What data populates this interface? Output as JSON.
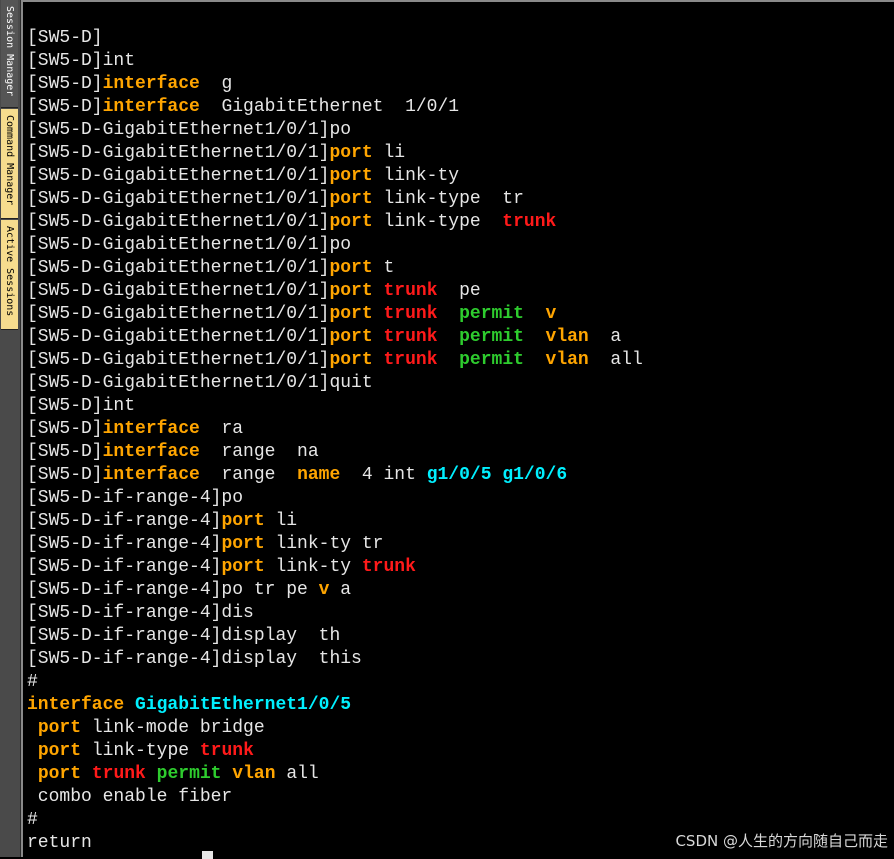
{
  "sidebar": {
    "tabs": [
      "Session Manager",
      "Command Manager",
      "Active Sessions"
    ]
  },
  "terminal": {
    "lines": [
      [
        [
          "[SW5-D]",
          "w"
        ]
      ],
      [
        [
          "[SW5-D]int",
          "w"
        ]
      ],
      [
        [
          "[SW5-D]",
          "w"
        ],
        [
          "interface",
          "o"
        ],
        [
          "  g",
          "w"
        ]
      ],
      [
        [
          "[SW5-D]",
          "w"
        ],
        [
          "interface",
          "o"
        ],
        [
          "  GigabitEthernet  1/0/1",
          "w"
        ]
      ],
      [
        [
          "[SW5-D-GigabitEthernet1/0/1]po",
          "w"
        ]
      ],
      [
        [
          "[SW5-D-GigabitEthernet1/0/1]",
          "w"
        ],
        [
          "port",
          "o"
        ],
        [
          " li",
          "w"
        ]
      ],
      [
        [
          "[SW5-D-GigabitEthernet1/0/1]",
          "w"
        ],
        [
          "port",
          "o"
        ],
        [
          " link-ty",
          "w"
        ]
      ],
      [
        [
          "[SW5-D-GigabitEthernet1/0/1]",
          "w"
        ],
        [
          "port",
          "o"
        ],
        [
          " link-type  tr",
          "w"
        ]
      ],
      [
        [
          "[SW5-D-GigabitEthernet1/0/1]",
          "w"
        ],
        [
          "port",
          "o"
        ],
        [
          " link-type  ",
          "w"
        ],
        [
          "trunk",
          "r"
        ]
      ],
      [
        [
          "[SW5-D-GigabitEthernet1/0/1]po",
          "w"
        ]
      ],
      [
        [
          "[SW5-D-GigabitEthernet1/0/1]",
          "w"
        ],
        [
          "port",
          "o"
        ],
        [
          " t",
          "w"
        ]
      ],
      [
        [
          "[SW5-D-GigabitEthernet1/0/1]",
          "w"
        ],
        [
          "port",
          "o"
        ],
        [
          " ",
          "w"
        ],
        [
          "trunk",
          "r"
        ],
        [
          "  pe",
          "w"
        ]
      ],
      [
        [
          "[SW5-D-GigabitEthernet1/0/1]",
          "w"
        ],
        [
          "port",
          "o"
        ],
        [
          " ",
          "w"
        ],
        [
          "trunk",
          "r"
        ],
        [
          "  ",
          "w"
        ],
        [
          "permit",
          "g"
        ],
        [
          "  ",
          "w"
        ],
        [
          "v",
          "o"
        ]
      ],
      [
        [
          "[SW5-D-GigabitEthernet1/0/1]",
          "w"
        ],
        [
          "port",
          "o"
        ],
        [
          " ",
          "w"
        ],
        [
          "trunk",
          "r"
        ],
        [
          "  ",
          "w"
        ],
        [
          "permit",
          "g"
        ],
        [
          "  ",
          "w"
        ],
        [
          "vlan",
          "o"
        ],
        [
          "  a",
          "w"
        ]
      ],
      [
        [
          "[SW5-D-GigabitEthernet1/0/1]",
          "w"
        ],
        [
          "port",
          "o"
        ],
        [
          " ",
          "w"
        ],
        [
          "trunk",
          "r"
        ],
        [
          "  ",
          "w"
        ],
        [
          "permit",
          "g"
        ],
        [
          "  ",
          "w"
        ],
        [
          "vlan",
          "o"
        ],
        [
          "  all",
          "w"
        ]
      ],
      [
        [
          "[SW5-D-GigabitEthernet1/0/1]quit",
          "w"
        ]
      ],
      [
        [
          "[SW5-D]int",
          "w"
        ]
      ],
      [
        [
          "[SW5-D]",
          "w"
        ],
        [
          "interface",
          "o"
        ],
        [
          "  ra",
          "w"
        ]
      ],
      [
        [
          "[SW5-D]",
          "w"
        ],
        [
          "interface",
          "o"
        ],
        [
          "  range  na",
          "w"
        ]
      ],
      [
        [
          "[SW5-D]",
          "w"
        ],
        [
          "interface",
          "o"
        ],
        [
          "  range  ",
          "w"
        ],
        [
          "name",
          "o"
        ],
        [
          "  4 int ",
          "w"
        ],
        [
          "g1/0/5 g1/0/6",
          "c"
        ]
      ],
      [
        [
          "[SW5-D-if-range-4]po",
          "w"
        ]
      ],
      [
        [
          "[SW5-D-if-range-4]",
          "w"
        ],
        [
          "port",
          "o"
        ],
        [
          " li",
          "w"
        ]
      ],
      [
        [
          "[SW5-D-if-range-4]",
          "w"
        ],
        [
          "port",
          "o"
        ],
        [
          " link-ty tr",
          "w"
        ]
      ],
      [
        [
          "[SW5-D-if-range-4]",
          "w"
        ],
        [
          "port",
          "o"
        ],
        [
          " link-ty ",
          "w"
        ],
        [
          "trunk",
          "r"
        ]
      ],
      [
        [
          "[SW5-D-if-range-4]po tr pe ",
          "w"
        ],
        [
          "v",
          "o"
        ],
        [
          " a",
          "w"
        ]
      ],
      [
        [
          "[SW5-D-if-range-4]dis",
          "w"
        ]
      ],
      [
        [
          "[SW5-D-if-range-4]display  th",
          "w"
        ]
      ],
      [
        [
          "[SW5-D-if-range-4]display  this",
          "w"
        ]
      ],
      [
        [
          "#",
          "w"
        ]
      ],
      [
        [
          "interface",
          "o"
        ],
        [
          " ",
          "w"
        ],
        [
          "GigabitEthernet1/0/5",
          "c"
        ]
      ],
      [
        [
          " ",
          "w"
        ],
        [
          "port",
          "o"
        ],
        [
          " link-mode bridge",
          "w"
        ]
      ],
      [
        [
          " ",
          "w"
        ],
        [
          "port",
          "o"
        ],
        [
          " link-type ",
          "w"
        ],
        [
          "trunk",
          "r"
        ]
      ],
      [
        [
          " ",
          "w"
        ],
        [
          "port",
          "o"
        ],
        [
          " ",
          "w"
        ],
        [
          "trunk",
          "r"
        ],
        [
          " ",
          "w"
        ],
        [
          "permit",
          "g"
        ],
        [
          " ",
          "w"
        ],
        [
          "vlan",
          "o"
        ],
        [
          " all",
          "w"
        ]
      ],
      [
        [
          " combo enable fiber",
          "w"
        ]
      ],
      [
        [
          "#",
          "w"
        ]
      ],
      [
        [
          "return",
          "w"
        ]
      ]
    ]
  },
  "watermark": "CSDN @人生的方向随自己而走",
  "colors": {
    "keyword": "#ffa500",
    "trunk": "#ff1a1a",
    "permit": "#2ecc2e",
    "interface_name": "#00f0ff",
    "text": "#e6e6e6",
    "background": "#000000"
  }
}
